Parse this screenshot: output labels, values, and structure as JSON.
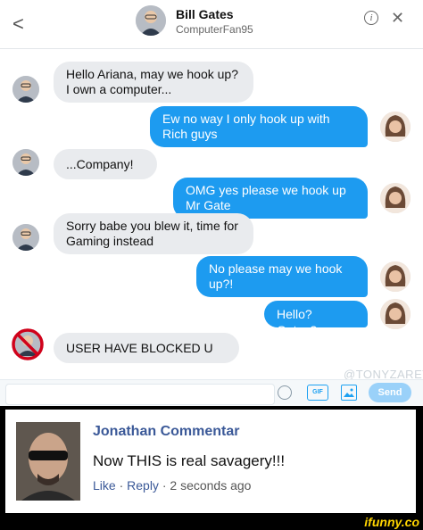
{
  "header": {
    "back_glyph": "<",
    "name": "Bill Gates",
    "handle": "ComputerFan95",
    "info_glyph": "i",
    "close_glyph": "✕"
  },
  "messages": [
    {
      "side": "in",
      "text": "Hello Ariana, may we hook up? I own a computer..."
    },
    {
      "side": "out",
      "text": "Ew no way I only hook up with Rich guys"
    },
    {
      "side": "in",
      "text": "...Company!"
    },
    {
      "side": "out",
      "text": "OMG yes please we hook up Mr Gate"
    },
    {
      "side": "in",
      "text": "Sorry babe you blew it, time for Gaming instead"
    },
    {
      "side": "out",
      "text": "No please may we hook up?!"
    },
    {
      "side": "out",
      "text": "Hello? Gates?"
    },
    {
      "side": "system",
      "text": "USER HAVE BLOCKED U"
    }
  ],
  "compose": {
    "gif_label": "GIF",
    "send_label": "Send"
  },
  "watermark": "@TONYZARET",
  "comment": {
    "author": "Jonathan Commentar",
    "text": "Now THIS is real savagery!!!",
    "like": "Like",
    "sep1": " · ",
    "reply": "Reply",
    "sep2": " · ",
    "time": "2 seconds ago"
  },
  "footer": {
    "logo": "ifunny.co"
  },
  "colors": {
    "outgoing_bubble": "#1d9bf0",
    "incoming_bubble": "#e9ebee",
    "facebook_link": "#3b5998",
    "ifunny_yellow": "#ffd400"
  }
}
